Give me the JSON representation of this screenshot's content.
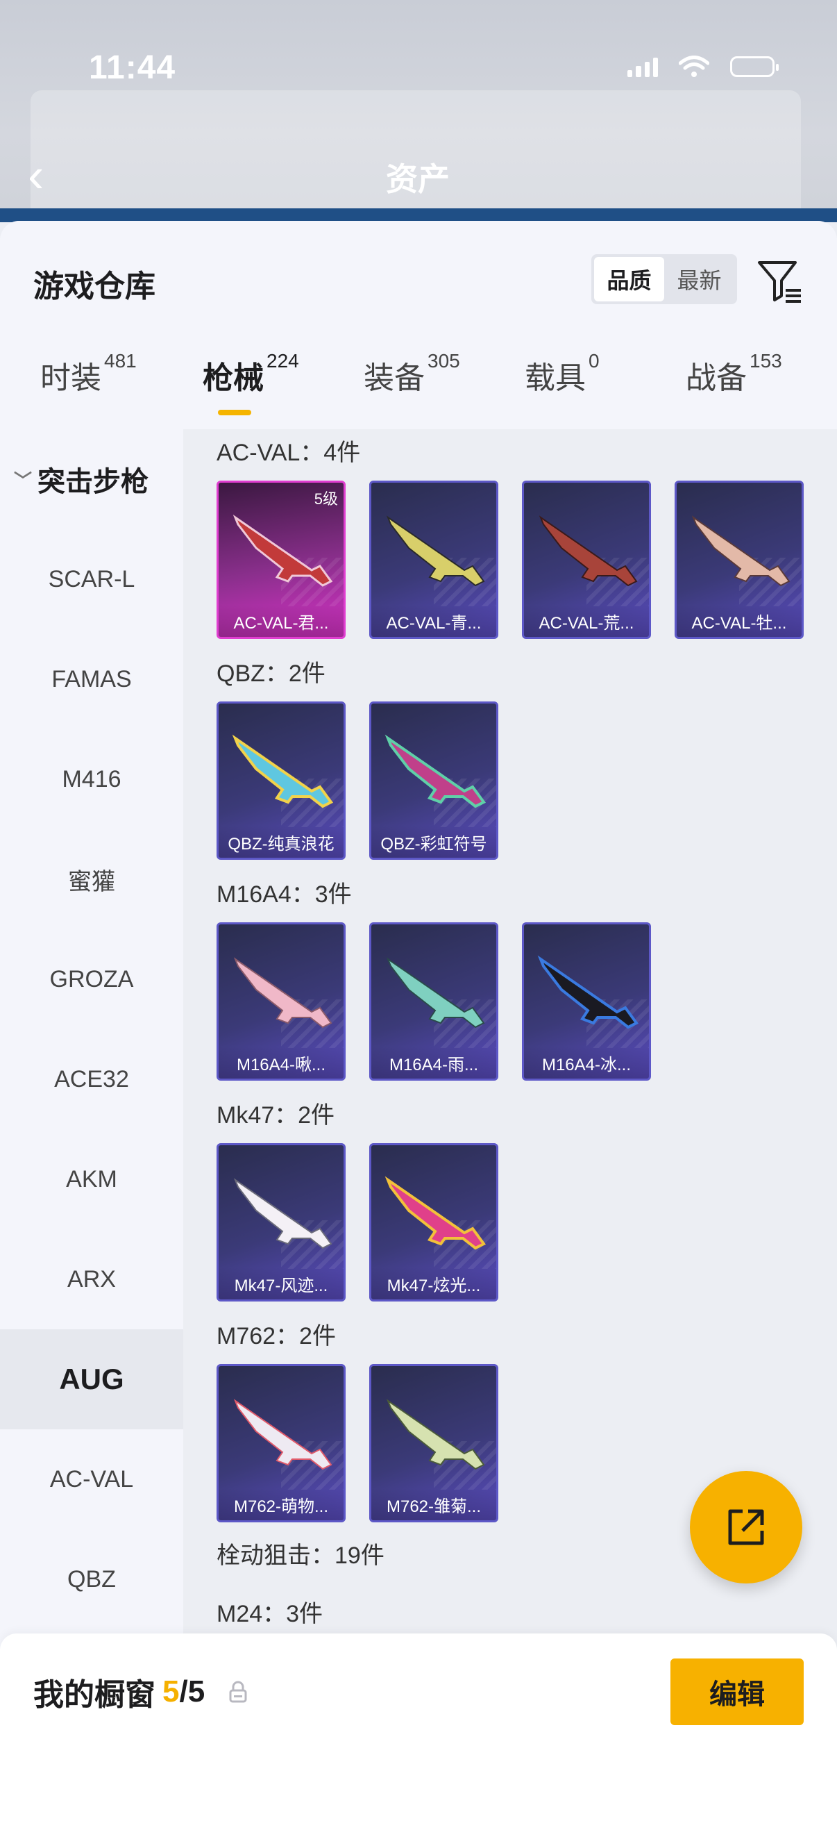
{
  "status": {
    "time": "11:44"
  },
  "backdrop": {
    "title": "资产"
  },
  "panel": {
    "title": "游戏仓库",
    "sort": {
      "options": [
        "品质",
        "最新"
      ],
      "active": "品质"
    }
  },
  "tabs": [
    {
      "label": "时装",
      "count": "481"
    },
    {
      "label": "枪械",
      "count": "224"
    },
    {
      "label": "装备",
      "count": "305"
    },
    {
      "label": "载具",
      "count": "0"
    },
    {
      "label": "战备",
      "count": "153"
    }
  ],
  "sidebar": {
    "header": "突击步枪",
    "items": [
      "SCAR-L",
      "FAMAS",
      "M416",
      "蜜獾",
      "GROZA",
      "ACE32",
      "AKM",
      "ARX",
      "AUG",
      "AC-VAL",
      "QBZ"
    ],
    "selected": "AUG"
  },
  "sections": [
    {
      "title": "AC-VAL：4件",
      "items": [
        {
          "name": "AC-VAL-君...",
          "level": "5级",
          "rarity": "legendary"
        },
        {
          "name": "AC-VAL-青...",
          "rarity": "epic"
        },
        {
          "name": "AC-VAL-荒...",
          "rarity": "epic"
        },
        {
          "name": "AC-VAL-牡...",
          "rarity": "epic"
        }
      ]
    },
    {
      "title": "QBZ：2件",
      "items": [
        {
          "name": "QBZ-纯真浪花",
          "rarity": "epic"
        },
        {
          "name": "QBZ-彩虹符号",
          "rarity": "epic"
        }
      ]
    },
    {
      "title": "M16A4：3件",
      "items": [
        {
          "name": "M16A4-啾...",
          "rarity": "epic"
        },
        {
          "name": "M16A4-雨...",
          "rarity": "epic"
        },
        {
          "name": "M16A4-冰...",
          "rarity": "epic"
        }
      ]
    },
    {
      "title": "Mk47：2件",
      "items": [
        {
          "name": "Mk47-风迹...",
          "rarity": "epic"
        },
        {
          "name": "Mk47-炫光...",
          "rarity": "epic"
        }
      ]
    },
    {
      "title": "M762：2件",
      "items": [
        {
          "name": "M762-萌物...",
          "rarity": "epic"
        },
        {
          "name": "M762-雏菊...",
          "rarity": "epic"
        }
      ]
    }
  ],
  "category_title": "栓动狙击：19件",
  "next_section_title": "M24：3件",
  "bottom": {
    "title": "我的橱窗",
    "count": "5",
    "separator": "/",
    "total": "5",
    "edit_label": "编辑"
  },
  "colors": {
    "accent": "#f7b100",
    "card_epic": "#3b3a78",
    "card_legendary": "#d632c6"
  }
}
